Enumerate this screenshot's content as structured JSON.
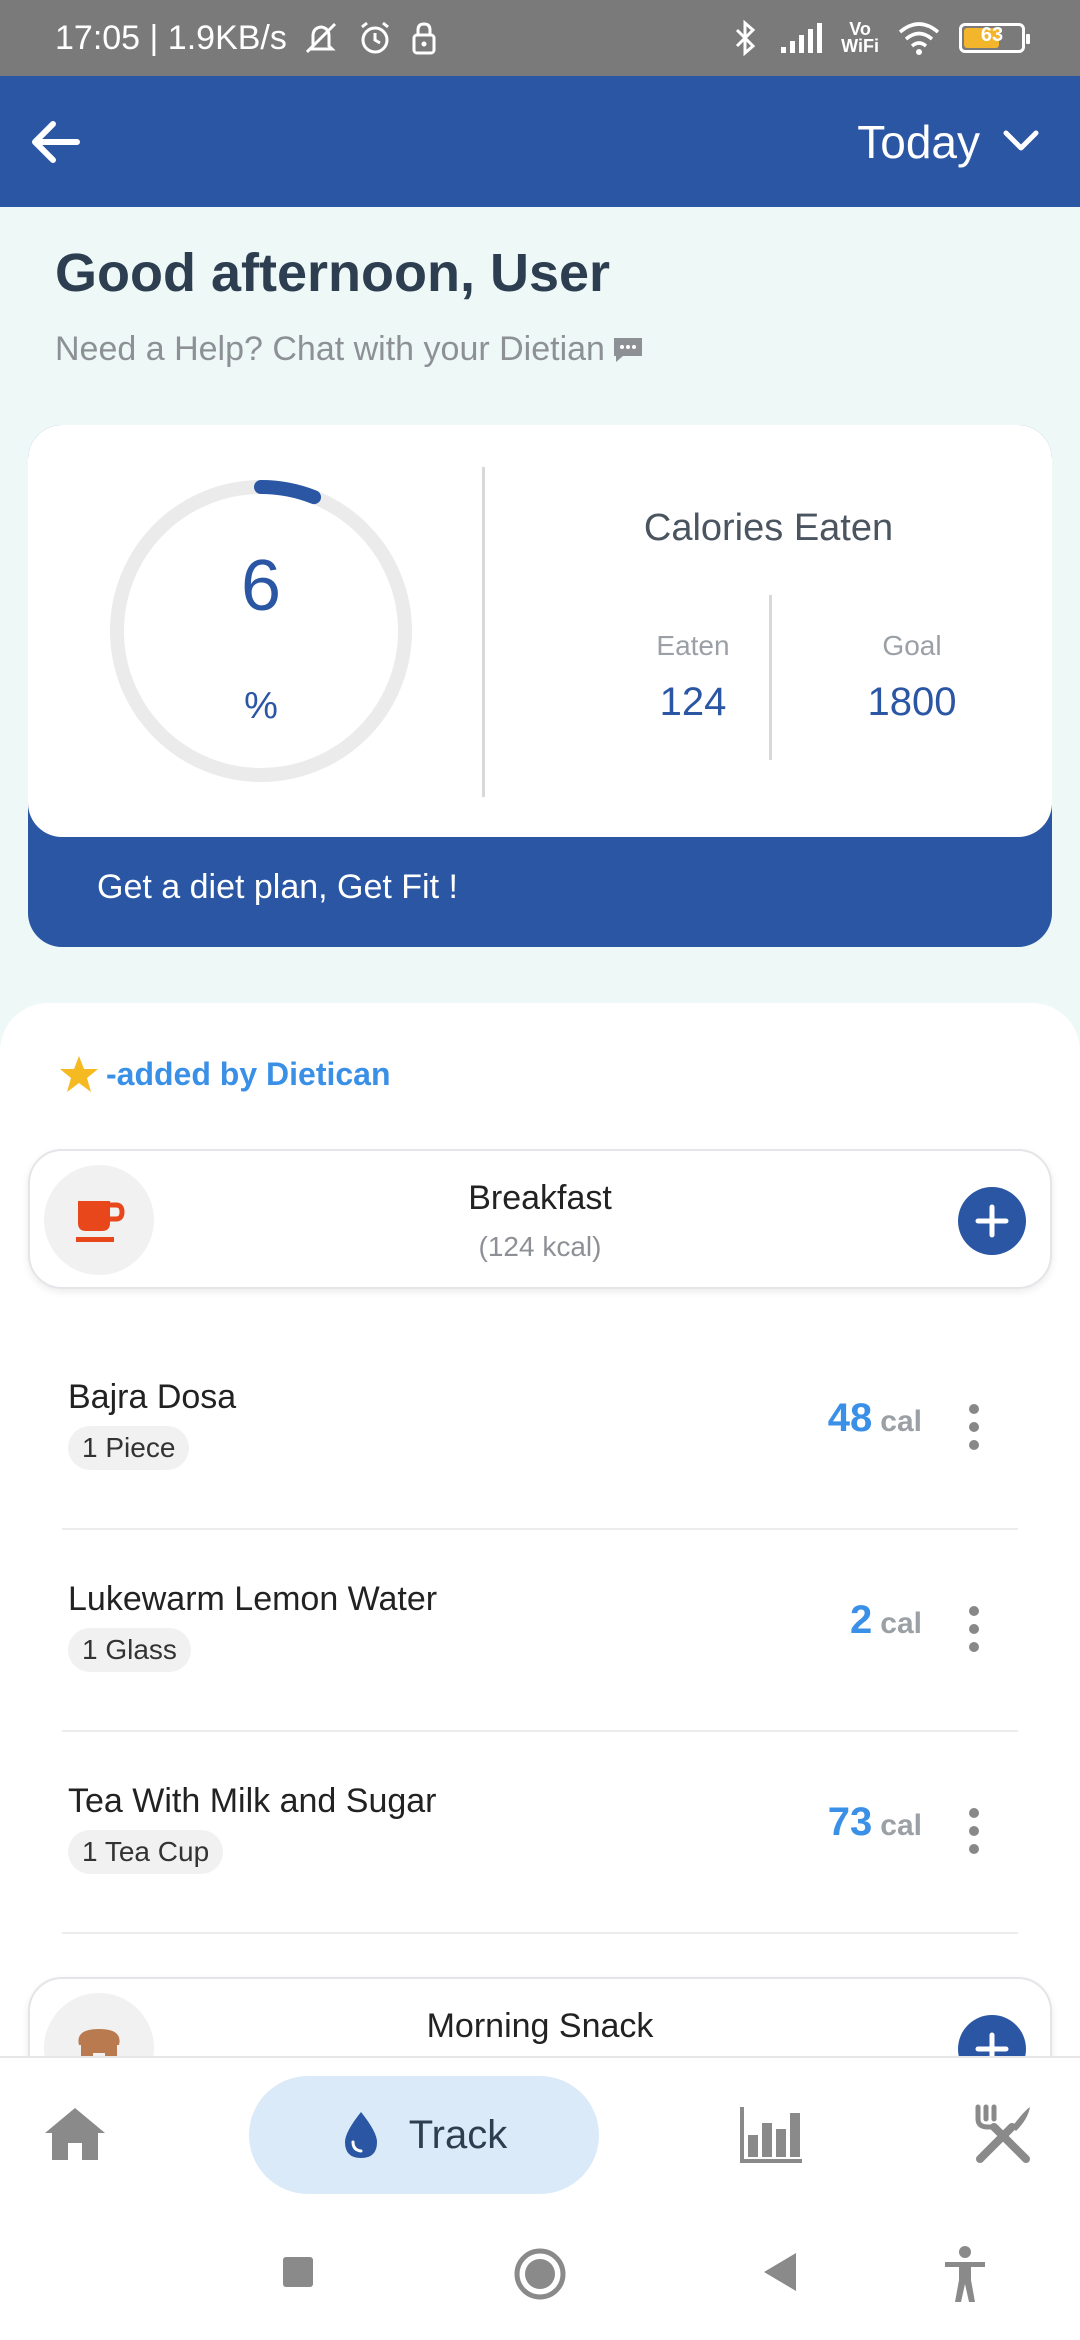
{
  "status_bar": {
    "left_text": "17:05 | 1.9KB/s",
    "battery": "63",
    "network_label_top": "Vo",
    "network_label_bottom": "WiFi"
  },
  "app_bar": {
    "date_label": "Today"
  },
  "greeting": {
    "title": "Good afternoon, User",
    "help_text": "Need a Help? Chat with your Dietian"
  },
  "calories": {
    "progress_value": "6",
    "progress_unit": "%",
    "progress_fraction": 0.06,
    "title": "Calories Eaten",
    "eaten_label": "Eaten",
    "eaten_value": "124",
    "goal_label": "Goal",
    "goal_value": "1800",
    "cta": "Get a diet plan, Get Fit !"
  },
  "legend": {
    "text": "-added by Dietican"
  },
  "meals": [
    {
      "name": "Breakfast",
      "kcal": "(124 kcal)",
      "icon": "cup-icon",
      "items": [
        {
          "name": "Bajra Dosa",
          "qty": "1 Piece",
          "cal": "48",
          "unit": "cal"
        },
        {
          "name": "Lukewarm Lemon Water",
          "qty": "1 Glass",
          "cal": "2",
          "unit": "cal"
        },
        {
          "name": "Tea With Milk and Sugar",
          "qty": "1 Tea Cup",
          "cal": "73",
          "unit": "cal"
        }
      ]
    },
    {
      "name": "Morning Snack",
      "icon": "bread-icon"
    }
  ],
  "bottom_nav": {
    "track_label": "Track"
  },
  "colors": {
    "primary": "#2a56a4",
    "accent": "#3a8fe6",
    "background": "#eef8f7"
  }
}
